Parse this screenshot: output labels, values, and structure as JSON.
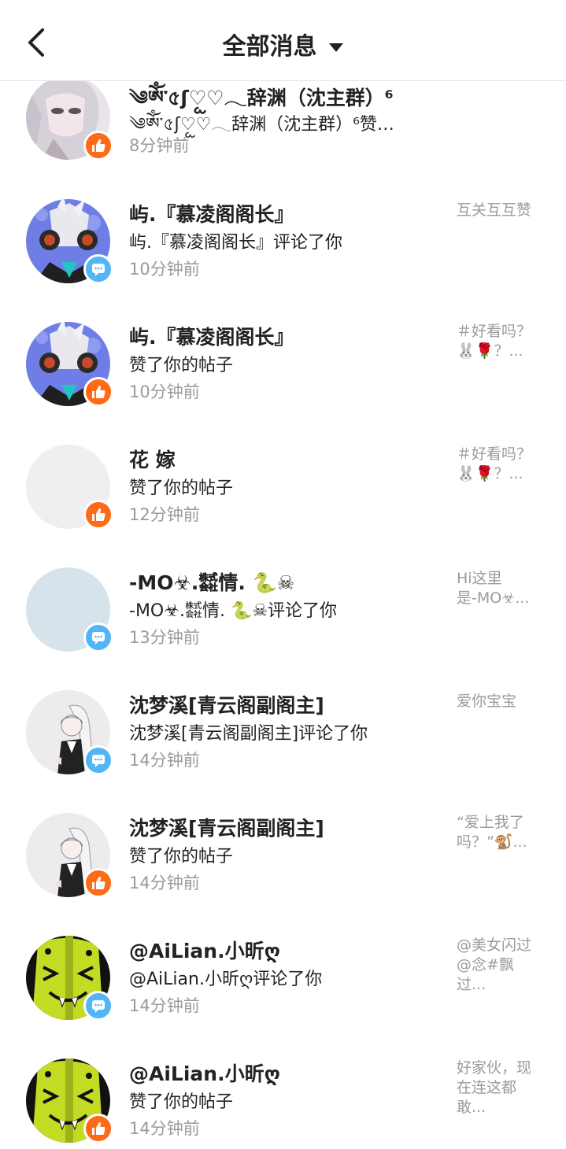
{
  "header": {
    "title": "全部消息",
    "back_icon": "chevron-left-icon",
    "dropdown_icon": "caret-down-icon"
  },
  "colors": {
    "like_badge": "#ff6a16",
    "comment_badge": "#52b5f5",
    "time_text": "#9a9a9a",
    "preview_text": "#9b9b9b"
  },
  "messages": [
    {
      "name": "༄ༀ་৫ʃ♡ᩬ♡𓂃辞渊（沈主群）⁶",
      "action": "༄ༀ་৫ʃ♡ᩬ♡𓂃辞渊（沈主群）⁶赞…",
      "time": "8分钟前",
      "type": "like",
      "preview": ""
    },
    {
      "name": "屿.『慕凌阁阁长』",
      "action": "屿.『慕凌阁阁长』评论了你",
      "time": "10分钟前",
      "type": "comment",
      "preview": "互关互互赞"
    },
    {
      "name": "屿.『慕凌阁阁长』",
      "action": "赞了你的帖子",
      "time": "10分钟前",
      "type": "like",
      "preview": "＃好看吗？\n🐰🌹？..."
    },
    {
      "name": "花 嫁",
      "action": "赞了你的帖子",
      "time": "12分钟前",
      "type": "like",
      "preview": "＃好看吗？\n🐰🌹？..."
    },
    {
      "name": "-MO☣.㍿情. 🐍☠",
      "action": "-MO☣.㍿情. 🐍☠评论了你",
      "time": "13分钟前",
      "type": "comment",
      "preview": "Hi这里\n是-MO☣..."
    },
    {
      "name": "沈梦溪[青云阁副阁主]",
      "action": "沈梦溪[青云阁副阁主]评论了你",
      "time": "14分钟前",
      "type": "comment",
      "preview": "爱你宝宝"
    },
    {
      "name": "沈梦溪[青云阁副阁主]",
      "action": "赞了你的帖子",
      "time": "14分钟前",
      "type": "like",
      "preview": "“爱上我了\n吗？”🐒..."
    },
    {
      "name": "@AiLian.小昕ღ",
      "action": "@AiLian.小昕ღ评论了你",
      "time": "14分钟前",
      "type": "comment",
      "preview": "@美女闪过\n@念#飘过..."
    },
    {
      "name": "@AiLian.小昕ღ",
      "action": "赞了你的帖子",
      "time": "14分钟前",
      "type": "like",
      "preview": "好家伙，现\n在连这都\n敢..."
    }
  ]
}
